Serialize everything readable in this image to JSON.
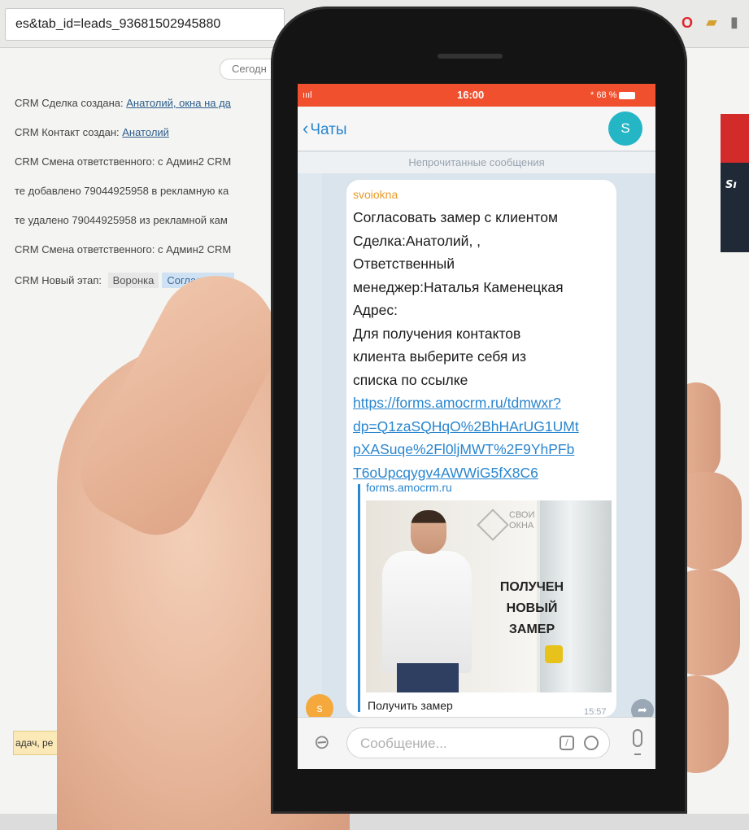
{
  "browser": {
    "url": "es&tab_id=leads_93681502945880",
    "date_divider": "Сегодн",
    "feed": [
      {
        "prefix": "CRM  Сделка создана: ",
        "link": "Анатолий, окна на да",
        "chips": []
      },
      {
        "prefix": "CRM  Контакт создан: ",
        "link": "Анатолий",
        "chips": []
      },
      {
        "prefix": "CRM  Смена ответственного: с Админ2 CRM",
        "link": "",
        "chips": []
      },
      {
        "prefix": "те добавлено 79044925958 в рекламную ка",
        "link": "",
        "chips": []
      },
      {
        "prefix": "те удалено 79044925958 из рекламной кам",
        "link": "",
        "chips": []
      },
      {
        "prefix": "CRM  Смена ответственного: с Админ2 CRM",
        "link": "",
        "chips": []
      },
      {
        "prefix": "CRM  Новый этап: ",
        "link": "",
        "chips": [
          "Воронка",
          "Согласовать"
        ]
      }
    ],
    "bottom_note": "адач, ре"
  },
  "phone": {
    "status": {
      "signal": "ıııl",
      "time": "16:00",
      "battery": "* 68 %"
    },
    "nav": {
      "back_label": "Чаты",
      "avatar_letter": "S"
    },
    "unread_label": "Непрочитанные сообщения",
    "message": {
      "sender": "svoiokna",
      "lines": [
        "Согласовать замер с клиентом",
        "Сделка:Анатолий, ,",
        "Ответственный",
        "менеджер:Наталья Каменецкая",
        "Адрес:",
        "Для получения контактов",
        "клиента выберите себя из",
        "списка по ссылке"
      ],
      "link_lines": [
        "https://forms.amocrm.ru/tdmwxr?",
        "dp=Q1zaSQHqO%2BhHArUG1UMt",
        "pXASuqe%2Fl0ljMWT%2F9YhPFb",
        "T6oUpcqygv4AWWiG5fX8C6"
      ],
      "preview_site": "forms.amocrm.ru",
      "preview_logo": "СВОИ\nОКНА",
      "preview_promo": [
        "ПОЛУЧЕН",
        "НОВЫЙ",
        "ЗАМЕР"
      ],
      "preview_caption": "Получить замер",
      "time": "15:57",
      "avatar_letter": "s"
    },
    "input": {
      "placeholder": "Сообщение..."
    }
  }
}
